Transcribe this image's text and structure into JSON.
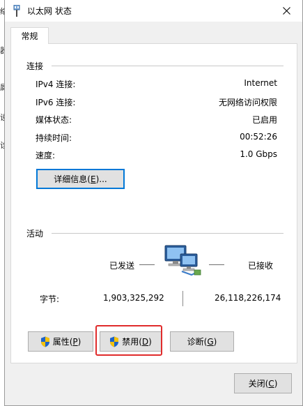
{
  "background_window": {
    "glyphs": [
      "络",
      "器",
      "设",
      "属",
      "诊"
    ]
  },
  "window": {
    "title": "以太网 状态"
  },
  "tabs": [
    {
      "label": "常规"
    }
  ],
  "connection": {
    "heading": "连接",
    "rows": [
      {
        "label": "IPv4 连接:",
        "value": "Internet"
      },
      {
        "label": "IPv6 连接:",
        "value": "无网络访问权限"
      },
      {
        "label": "媒体状态:",
        "value": "已启用"
      },
      {
        "label": "持续时间:",
        "value": "00:52:26"
      },
      {
        "label": "速度:",
        "value": "1.0 Gbps"
      }
    ],
    "details_button": {
      "label": "详细信息(",
      "mnemonic": "E",
      "suffix": ")..."
    }
  },
  "activity": {
    "heading": "活动",
    "sent_label": "已发送",
    "received_label": "已接收",
    "bytes_label": "字节:",
    "bytes_sent": "1,903,325,292",
    "bytes_received": "26,118,226,174"
  },
  "buttons": {
    "properties": {
      "label": "属性(",
      "mnemonic": "P",
      "suffix": ")"
    },
    "disable": {
      "label": "禁用(",
      "mnemonic": "D",
      "suffix": ")"
    },
    "diagnose": {
      "label": "诊断(",
      "mnemonic": "G",
      "suffix": ")"
    },
    "close": {
      "label": "关闭(",
      "mnemonic": "C",
      "suffix": ")"
    }
  },
  "colors": {
    "accent": "#0078d7",
    "highlight_box": "#e02b2b",
    "dialog_bg": "#f0f0f0",
    "panel_bg": "#ffffff"
  },
  "icons": [
    "network-adapter-icon",
    "close-icon",
    "network-computers-icon",
    "uac-shield-icon"
  ]
}
